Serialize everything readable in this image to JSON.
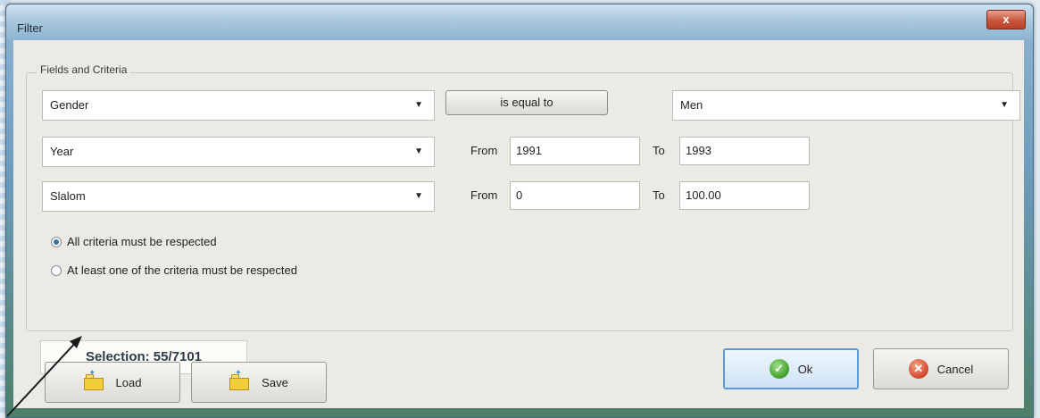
{
  "window": {
    "title": "Filter",
    "close_glyph": "x"
  },
  "group": {
    "label": "Fields and Criteria"
  },
  "rows": [
    {
      "field": "Gender",
      "operator": "is equal to",
      "value": "Men"
    },
    {
      "field": "Year",
      "from_label": "From",
      "from_value": "1991",
      "to_label": "To",
      "to_value": "1993"
    },
    {
      "field": "Slalom",
      "from_label": "From",
      "from_value": "0",
      "to_label": "To",
      "to_value": "100.00"
    }
  ],
  "match_mode": {
    "options": [
      {
        "label": "All criteria must be respected",
        "checked": true
      },
      {
        "label": "At least one of the criteria must be respected",
        "checked": false
      }
    ]
  },
  "selection": {
    "text": "Selection: 55/7101"
  },
  "buttons": {
    "load": "Load",
    "save": "Save",
    "ok": "Ok",
    "cancel": "Cancel"
  },
  "icons": {
    "close": "close-icon",
    "dropdown": "chevron-down-icon",
    "load": "folder-icon",
    "save": "folder-icon",
    "ok": "check-circle-icon",
    "cancel": "cancel-circle-icon"
  },
  "colors": {
    "accent": "#5a9ad6",
    "ok": "#3f9e2a",
    "cancel": "#d2452a"
  }
}
